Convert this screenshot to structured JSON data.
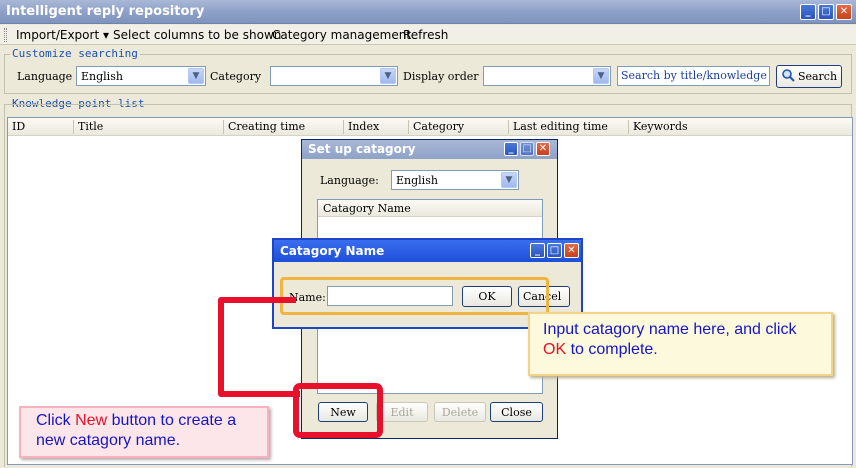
{
  "window": {
    "title": "Intelligent reply repository"
  },
  "menu": {
    "import_export": "Import/Export ▾",
    "select_columns": "Select columns to be shown",
    "category_management": "Category management",
    "refresh": "Refresh"
  },
  "search_group": {
    "label": "Customize searching",
    "language_label": "Language",
    "language_value": "English",
    "category_label": "Category",
    "category_value": "",
    "display_order_label": "Display order",
    "display_order_value": "",
    "search_text": "Search by title/knowledge",
    "search_button": "Search"
  },
  "list_group": {
    "label": "Knowledge point list",
    "columns": [
      "ID",
      "Title",
      "Creating time",
      "Index",
      "Category",
      "Last editing time",
      "Keywords"
    ]
  },
  "setup_dialog": {
    "title": "Set up catagory",
    "language_label": "Language:",
    "language_value": "English",
    "list_header": "Catagory Name",
    "buttons": {
      "new": "New",
      "edit": "Edit",
      "delete": "Delete",
      "close": "Close"
    }
  },
  "name_dialog": {
    "title": "Catagory Name",
    "name_label": "Name:",
    "name_value": "",
    "ok": "OK",
    "cancel": "Cancel"
  },
  "callouts": {
    "right": {
      "text1": "Input catagory name here, and click ",
      "highlight": "OK",
      "text2": " to complete."
    },
    "left": {
      "text1": "Click ",
      "highlight": "New",
      "text2": " button to create a new catagory name."
    }
  },
  "colors": {
    "highlight_red": "#e8102a",
    "annotation_blue": "#1515c8",
    "annotation_orange": "#f2b340"
  },
  "icons": [
    "minimize-icon",
    "maximize-icon",
    "close-icon",
    "chevron-down-icon",
    "search-icon"
  ]
}
